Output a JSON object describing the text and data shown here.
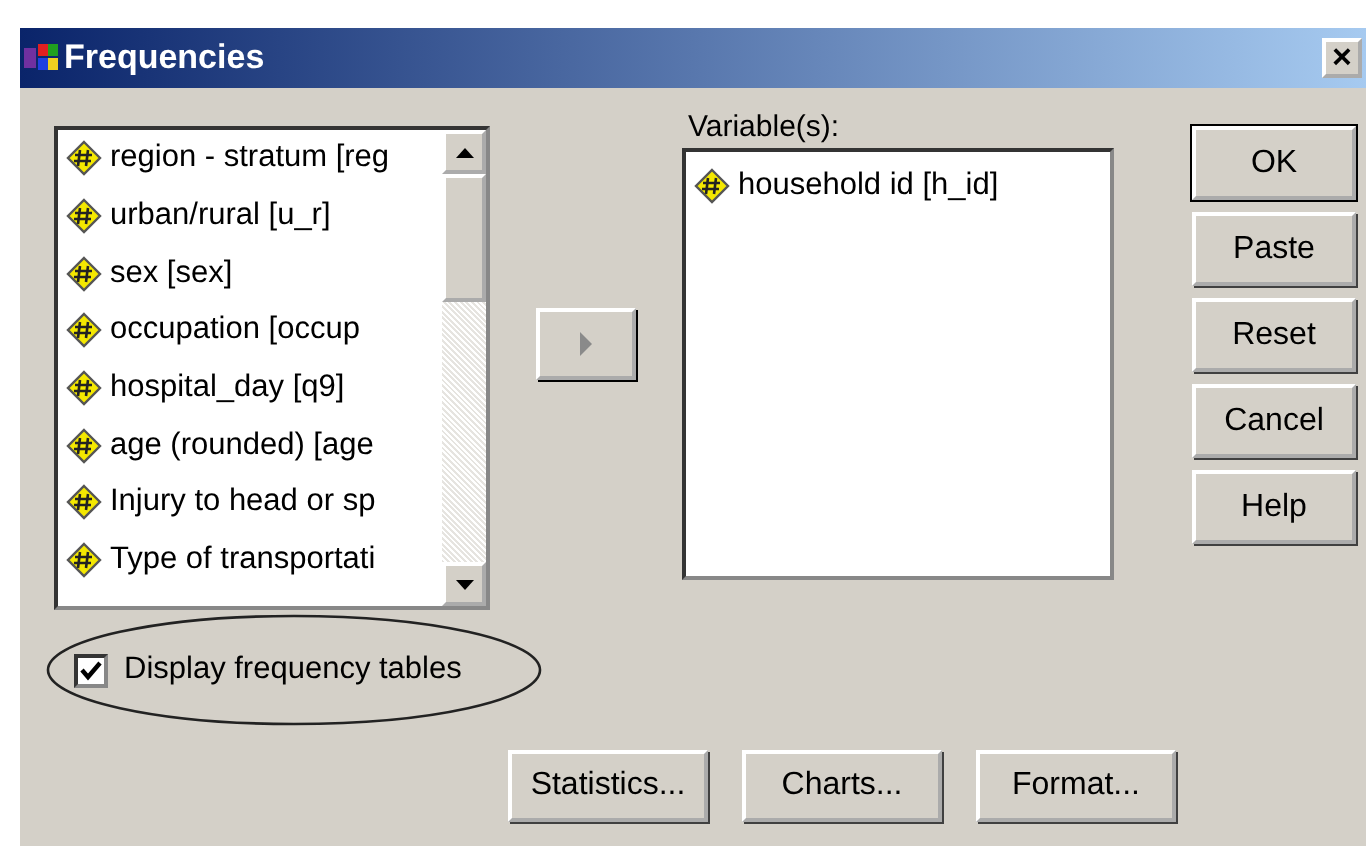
{
  "window": {
    "title": "Frequencies",
    "close": "×"
  },
  "source_list": {
    "items": [
      {
        "label": "region - stratum [reg"
      },
      {
        "label": "urban/rural [u_r]"
      },
      {
        "label": "sex [sex]"
      },
      {
        "label": "occupation [occup"
      },
      {
        "label": "hospital_day [q9]"
      },
      {
        "label": "age (rounded) [age"
      },
      {
        "label": "Injury to head or sp"
      },
      {
        "label": "Type of transportati"
      }
    ]
  },
  "target_list": {
    "label": "Variable(s):",
    "items": [
      {
        "label": "household id [h_id]"
      }
    ]
  },
  "display_frequency_tables": {
    "label": "Display frequency tables",
    "checked": true,
    "highlighted": true
  },
  "side_buttons": [
    {
      "label": "OK",
      "default": true
    },
    {
      "label": "Paste",
      "default": false
    },
    {
      "label": "Reset",
      "default": false
    },
    {
      "label": "Cancel",
      "default": false
    },
    {
      "label": "Help",
      "default": false
    }
  ],
  "bottom_buttons": [
    "Statistics...",
    "Charts...",
    "Format..."
  ]
}
